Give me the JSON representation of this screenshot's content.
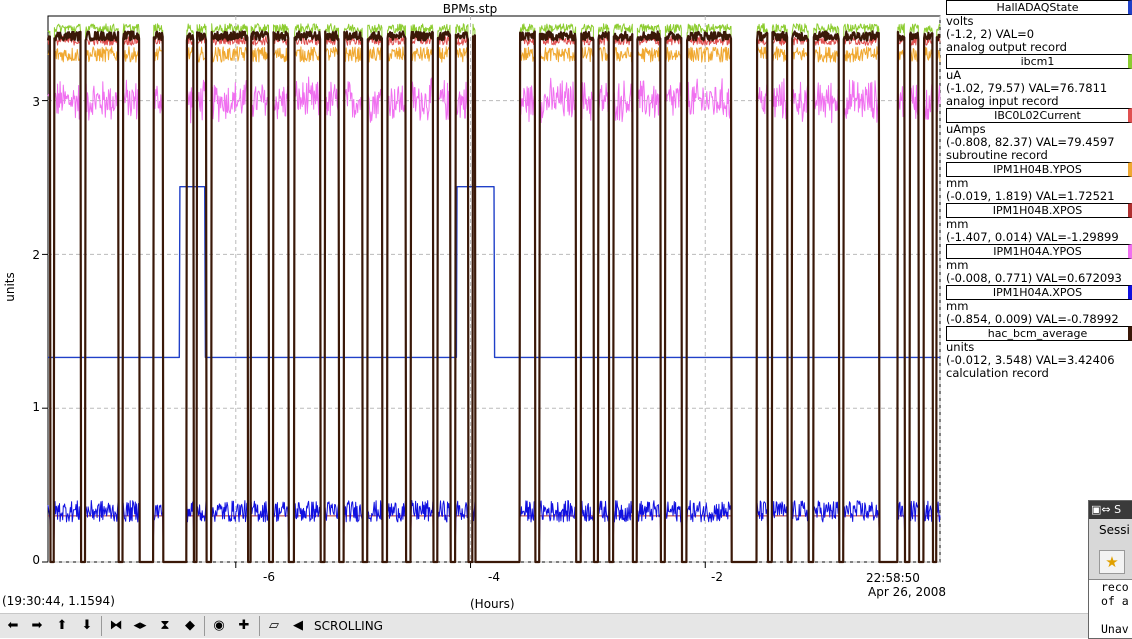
{
  "window": {
    "title": "BPMs.stp"
  },
  "chart_data": {
    "type": "line",
    "title": "BPMs.stp",
    "ylabel": "units",
    "xlabel": "(Hours)",
    "ylim": [
      0,
      3.55
    ],
    "xlim": [
      -7.6,
      0
    ],
    "yticks": [
      0,
      1,
      2,
      3
    ],
    "xticks": [
      -6,
      -4,
      -2
    ],
    "x_last_label": "22:58:50",
    "x_last_date": "Apr 26, 2008",
    "grid": true,
    "beam_off_intervals_hours": [
      [
        -7.58,
        -7.55
      ],
      [
        -7.32,
        -7.28
      ],
      [
        -7.0,
        -6.96
      ],
      [
        -6.82,
        -6.7
      ],
      [
        -6.62,
        -6.42
      ],
      [
        -6.36,
        -6.33
      ],
      [
        -6.25,
        -6.21
      ],
      [
        -5.9,
        -5.87
      ],
      [
        -5.72,
        -5.68
      ],
      [
        -5.55,
        -5.5
      ],
      [
        -5.28,
        -5.24
      ],
      [
        -5.12,
        -5.08
      ],
      [
        -4.92,
        -4.88
      ],
      [
        -4.75,
        -4.71
      ],
      [
        -4.55,
        -4.51
      ],
      [
        -4.32,
        -4.28
      ],
      [
        -4.17,
        -4.13
      ],
      [
        -4.02,
        -3.98
      ],
      [
        -3.96,
        -3.58
      ],
      [
        -3.45,
        -3.41
      ],
      [
        -3.1,
        -3.06
      ],
      [
        -2.95,
        -2.91
      ],
      [
        -2.82,
        -2.78
      ],
      [
        -2.62,
        -2.58
      ],
      [
        -2.38,
        -2.34
      ],
      [
        -2.2,
        -2.16
      ],
      [
        -1.78,
        -1.56
      ],
      [
        -1.47,
        -1.43
      ],
      [
        -1.3,
        -1.26
      ],
      [
        -1.12,
        -1.08
      ],
      [
        -0.86,
        -0.82
      ],
      [
        -0.52,
        -0.36
      ],
      [
        -0.3,
        -0.26
      ],
      [
        -0.18,
        -0.14
      ],
      [
        -0.06,
        -0.03
      ]
    ],
    "series": [
      {
        "name": "HallADAQState",
        "unit": "volts",
        "range": "(-1.2, 2) VAL=0",
        "type": "analog output record",
        "color": "#2040c8",
        "level": 1.33,
        "alt_level": 2.44,
        "alt_intervals": [
          [
            -6.48,
            -6.26
          ],
          [
            -4.12,
            -3.8
          ]
        ]
      },
      {
        "name": "ibcm1",
        "unit": "uA",
        "range": "(-1.02, 79.57) VAL=76.7811",
        "type": "analog input record",
        "color": "#8ccc30",
        "on_level": 3.47,
        "noise": 0.03
      },
      {
        "name": "IBC0L02Current",
        "unit": "uAmps",
        "range": "(-0.808, 82.37) VAL=79.4597",
        "type": "subroutine record",
        "color": "#e05050",
        "on_level": 3.39,
        "noise": 0.03
      },
      {
        "name": "IPM1H04B.YPOS",
        "unit": "mm",
        "range": "(-0.019, 1.819) VAL=1.72521",
        "type": "",
        "color": "#f0a830",
        "on_level": 3.3,
        "noise": 0.05
      },
      {
        "name": "IPM1H04B.XPOS",
        "unit": "mm",
        "range": "(-1.407, 0.014) VAL=-1.29899",
        "type": "",
        "color": "#b03030",
        "off_level": 0.3
      },
      {
        "name": "IPM1H04A.YPOS",
        "unit": "mm",
        "range": "(-0.008, 0.771) VAL=0.672093",
        "type": "",
        "color": "#f070f0",
        "on_level": 3.0,
        "noise": 0.1
      },
      {
        "name": "IPM1H04A.XPOS",
        "unit": "mm",
        "range": "(-0.854, 0.009) VAL=-0.78992",
        "type": "",
        "color": "#1010e0",
        "level": 0.33,
        "noise": 0.07
      },
      {
        "name": "hac_bcm_average",
        "unit": "units",
        "range": "(-0.012, 3.548) VAL=3.42406",
        "type": "calculation record",
        "color": "#3a1808",
        "on_level": 3.42,
        "noise": 0.03
      }
    ]
  },
  "cursor_readout": "(19:30:44, 1.1594)",
  "toolbar": {
    "buttons": [
      {
        "name": "pan-left-icon",
        "glyph": "⬅"
      },
      {
        "name": "pan-right-icon",
        "glyph": "➡"
      },
      {
        "name": "pan-up-icon",
        "glyph": "⬆"
      },
      {
        "name": "pan-down-icon",
        "glyph": "⬇"
      },
      {
        "name": "zoom-in-x-icon",
        "glyph": "⧓"
      },
      {
        "name": "zoom-out-x-icon",
        "glyph": "◂▸"
      },
      {
        "name": "zoom-in-y-icon",
        "glyph": "⧗"
      },
      {
        "name": "zoom-out-y-icon",
        "glyph": "◆"
      },
      {
        "name": "auto-zoom-icon",
        "glyph": "◉"
      },
      {
        "name": "crosshair-icon",
        "glyph": "✚"
      },
      {
        "name": "scroll-mode-icon",
        "glyph": "⏥"
      },
      {
        "name": "stop-scroll-icon",
        "glyph": "◀"
      }
    ],
    "mode": "SCROLLING"
  },
  "session_window": {
    "title": "S",
    "label": "Sessi",
    "text_lines": [
      "reco",
      "of a",
      "",
      "Unav"
    ]
  }
}
